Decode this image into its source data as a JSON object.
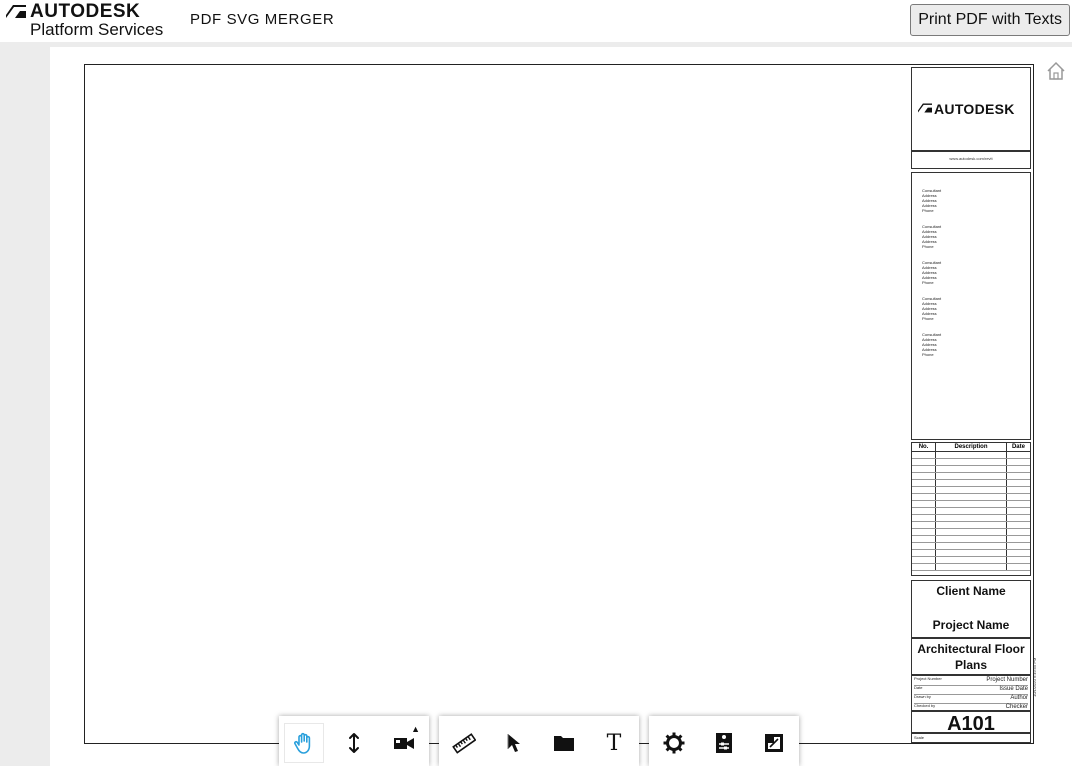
{
  "header": {
    "brand_top": "AUTODESK",
    "brand_bottom": "Platform Services",
    "app_title": "PDF SVG MERGER",
    "print_button": "Print PDF with Texts"
  },
  "viewer": {
    "home_icon": "home-icon"
  },
  "titleblock": {
    "logo_text": "AUTODESK",
    "url": "www.autodesk.com/revit",
    "consultants": [
      [
        "Consultant",
        "Address",
        "Address",
        "Address",
        "Phone"
      ],
      [
        "Consultant",
        "Address",
        "Address",
        "Address",
        "Phone"
      ],
      [
        "Consultant",
        "Address",
        "Address",
        "Address",
        "Phone"
      ],
      [
        "Consultant",
        "Address",
        "Address",
        "Address",
        "Phone"
      ],
      [
        "Consultant",
        "Address",
        "Address",
        "Address",
        "Phone"
      ]
    ],
    "revision_headers": [
      "No.",
      "Description",
      "Date"
    ],
    "client_name": "Client Name",
    "project_name": "Project Name",
    "sheet_name": "Architectural Floor Plans",
    "info": [
      {
        "label": "Project Number",
        "value": "Project Number"
      },
      {
        "label": "Date",
        "value": "Issue Date"
      },
      {
        "label": "Drawn by",
        "value": "Author"
      },
      {
        "label": "Checked by",
        "value": "Checker"
      }
    ],
    "sheet_number": "A101",
    "scale_label": "Scale",
    "timestamp": "10/1/2020 9:49:55 PM"
  },
  "toolbar": {
    "groups": [
      [
        "pan-icon",
        "zoom-icon",
        "camera-icon"
      ],
      [
        "measure-icon",
        "section-icon",
        "model-browser-icon",
        "text-icon"
      ],
      [
        "settings-icon",
        "properties-icon",
        "fullscreen-icon"
      ]
    ],
    "active_color": "#2aa0dc",
    "text_tool_glyph": "T",
    "caret": "▲"
  }
}
